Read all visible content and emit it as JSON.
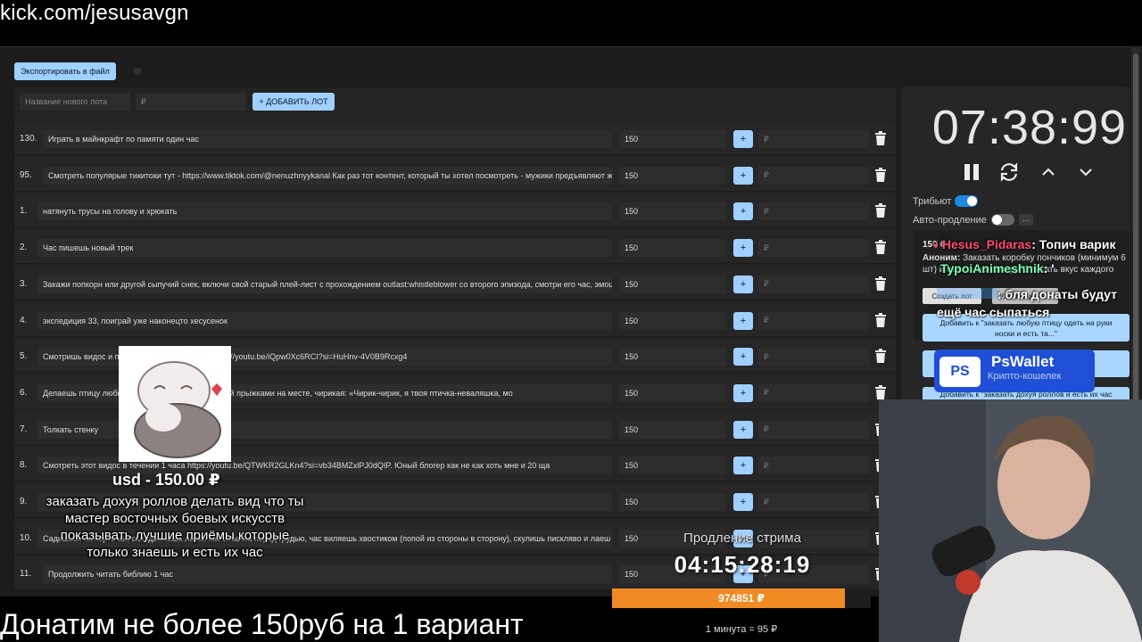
{
  "url_overlay": "kick.com/jesusavgn",
  "toolbar": {
    "export_label": "Экспортировать в файл"
  },
  "new_lot": {
    "name_placeholder": "Название нового лота",
    "price_placeholder": "₽",
    "add_label": "+ ДОБАВИТЬ ЛОТ"
  },
  "lots": [
    {
      "num": "130.",
      "title": "Играть в майнкрафт по памяти один час",
      "price": "150"
    },
    {
      "num": "95.",
      "title": "Смотреть популярые тикитоки тут - https://www.tiktok.com/@nenuzhnyykanal Как раз тот контент, который ты хотел посмотреть - мужики предъявляют жен",
      "price": "150"
    },
    {
      "num": "1.",
      "title": "натянуть трусы на голову и хрюкать",
      "price": "150"
    },
    {
      "num": "2.",
      "title": "Час пишешь новый трек",
      "price": "150"
    },
    {
      "num": "3.",
      "title": "Закажи попкорн или другой сыпучий снек, включи свой старый плей-лист с прохождением outlast:whistleblower со второго эпизода, смотри его час, эмоци",
      "price": "150"
    },
    {
      "num": "4.",
      "title": "экспедиция 33, поиграй уже наконецто хесусенок",
      "price": "150"
    },
    {
      "num": "5.",
      "title": "Смотришь видос и по                              чишься делать намаз. https://youtu.be/iQpw0Xc6RCI?si=HuHnv-4V0B9Rcxg4",
      "price": "150"
    },
    {
      "num": "6.",
      "title": "Делаешь птицу любви                              сле летаешь перед камерой прыжками на месте, чирикая: «Чирик-чирик, я твоя птичка-неваляшка, мо",
      "price": "150"
    },
    {
      "num": "7.",
      "title": "Толкать стенку",
      "price": "150"
    },
    {
      "num": "8.",
      "title": "Смотреть этот видос в течении 1 часа https://youtu.be/QTWKR2GLKn4?si=vb34BMZxlPJ0dQIP. Юный блогер как не как хоть мне и 20 ща",
      "price": "150"
    },
    {
      "num": "9.",
      "title": "",
      "price": "150"
    },
    {
      "num": "10.",
      "title": "Садишься на корточки, складываешь лапки как собачка перед грудью, час виляешь хвостиком (попой из стороны в сторону), скулишь писклявo и лаеш",
      "price": "150"
    },
    {
      "num": "11.",
      "title": "Продолжить читать библию 1 час",
      "price": "150"
    }
  ],
  "amount_placeholder": "₽",
  "timer": {
    "time": "07:38:99"
  },
  "tribute_label": "Трибьют",
  "auto_extend_label": "Авто-продление",
  "auto_extend_more": "...",
  "donation": {
    "amount": "150 ₽",
    "anon_label": "Аноним:",
    "text": "Заказать коробку пончиков (минимум 6 шт) и съесть на камеру. Описать вкус каждого",
    "create_lot": "Создать лот",
    "delete_donation": "Удалить дона..."
  },
  "suggestions": [
    "Добавить к \"заказать любую птицу одеть на руки носки и есть та...\"",
    "Добавить к \"заказать доху́я роллов и есть их час"
  ],
  "chat": [
    {
      "user": "Hesus_Pidaras",
      "msg": ": Топич варик",
      "color": "#ff4d6d"
    },
    {
      "user": "TypoiAnimeshnik",
      "msg": ": '",
      "color": "#7dffb0"
    },
    {
      "user": "",
      "msg": ": бля донаты будут ещё час сыпаться",
      "color": "#4aa3ff"
    }
  ],
  "pswallet": {
    "name": "PsWallet",
    "sub": "Крипто-кошелек",
    "logo": "PS"
  },
  "sticker_caption": "usd - 150.00 ₽",
  "donation_overlay": "заказать дохуя роллов делать вид что ты мастер восточных боевых искусств показывать лучшие приёмы которые только знаешь и есть их час",
  "extension": {
    "label": "Продление стрима",
    "time": "04:15:28:19",
    "total": "974851 ₽",
    "progress": 0.9,
    "rate": "1 минута = 95 ₽"
  },
  "bottom_banner": "Донатим не более 150руб на 1 вариант",
  "colors": {
    "accent": "#9fd0ff",
    "toggle_on": "#1e88e5",
    "progress": "#f08a24"
  }
}
